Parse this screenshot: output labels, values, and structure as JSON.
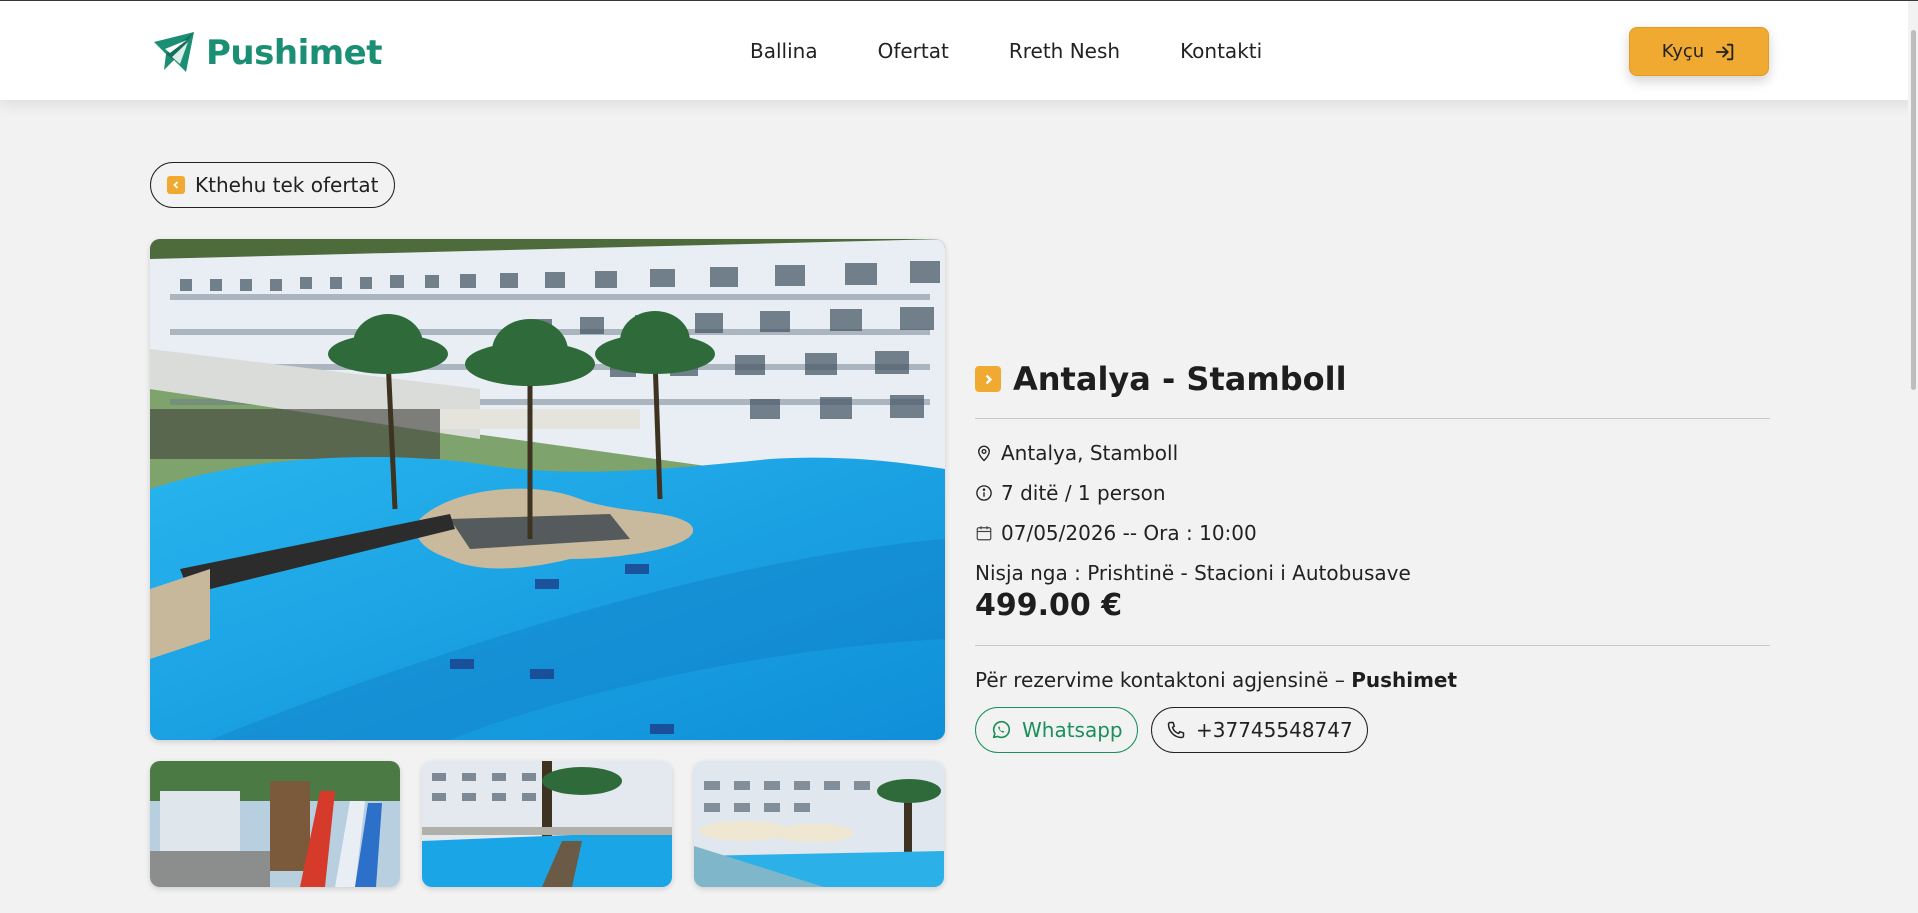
{
  "brand": {
    "name": "Pushimet",
    "accent": "#f0aa31",
    "green": "#1a8f73"
  },
  "nav": {
    "items": [
      "Ballina",
      "Ofertat",
      "Rreth Nesh",
      "Kontakti"
    ]
  },
  "header": {
    "login_label": "Kyçu"
  },
  "back": {
    "label": "Kthehu tek ofertat"
  },
  "offer": {
    "title": "Antalya - Stamboll",
    "location": "Antalya, Stamboll",
    "duration": "7 ditë / 1 person",
    "date": "07/05/2026 -- Ora : 10:00",
    "departure": "Nisja nga : Prishtinë - Stacioni i Autobusave",
    "price": "499.00 €"
  },
  "contact": {
    "text": "Për rezervime kontaktoni agjensinë –",
    "agency": "Pushimet",
    "whatsapp_label": "Whatsapp",
    "phone": "+37745548747"
  },
  "icons": {
    "logo": "plane-logo-icon",
    "login": "sign-in-icon",
    "back": "chevron-left-icon",
    "title": "chevron-right-icon",
    "location": "map-pin-icon",
    "duration": "info-icon",
    "date": "calendar-icon",
    "whatsapp": "whatsapp-icon",
    "phone": "phone-icon"
  }
}
